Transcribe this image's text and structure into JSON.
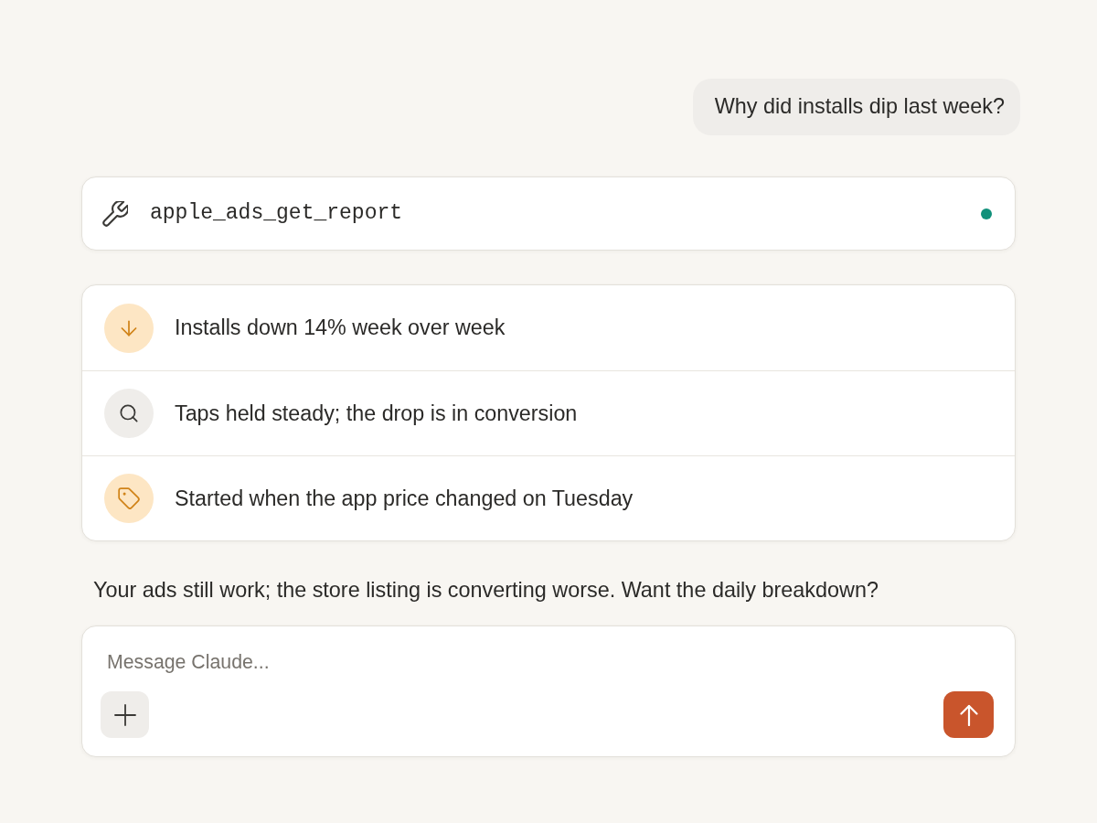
{
  "user_message": {
    "text": "Why did installs dip last week?"
  },
  "tool_call": {
    "name": "apple_ads_get_report",
    "complete": true
  },
  "findings": [
    {
      "kind": "decline",
      "text": "Installs down 14% week over week"
    },
    {
      "kind": "search",
      "text": "Taps held steady; the drop is in conversion"
    },
    {
      "kind": "price",
      "text": "Started when the app price changed on Tuesday"
    }
  ],
  "assistant_reply": {
    "text": "Your ads still work; the store listing is converting worse. Want the daily breakdown?"
  },
  "composer": {
    "placeholder": "Message Claude..."
  }
}
